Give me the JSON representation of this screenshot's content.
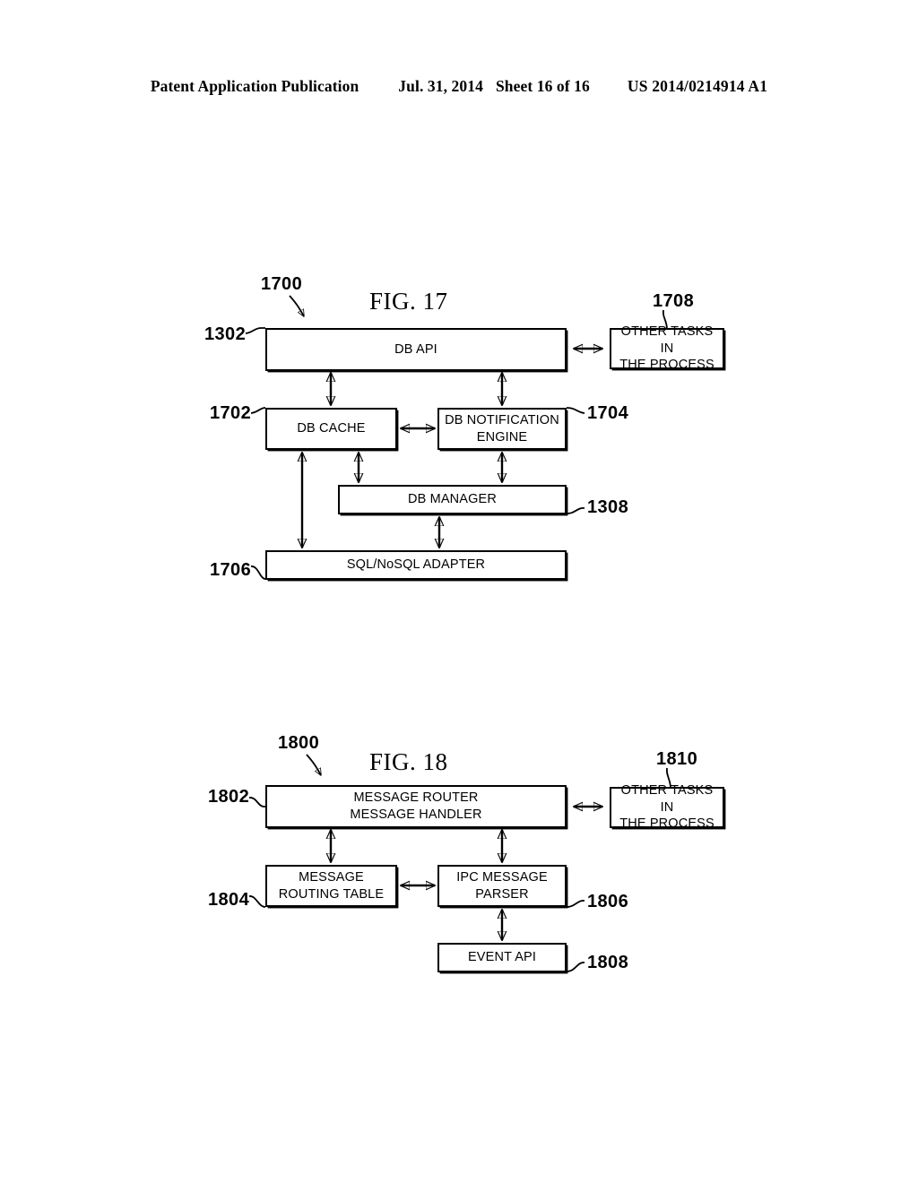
{
  "header": {
    "publication": "Patent Application Publication",
    "date": "Jul. 31, 2014",
    "sheet": "Sheet 16 of 16",
    "patent_number": "US 2014/0214914 A1"
  },
  "figures": [
    {
      "id": "fig-17",
      "title": "FIG. 17",
      "figure_ref": "1700",
      "boxes": [
        {
          "ref": "1302",
          "label": "DB API"
        },
        {
          "ref": "1708",
          "label": "OTHER TASKS IN\nTHE PROCESS"
        },
        {
          "ref": "1702",
          "label": "DB CACHE"
        },
        {
          "ref": "1704",
          "label": "DB NOTIFICATION\nENGINE"
        },
        {
          "ref": "1308",
          "label": "DB MANAGER"
        },
        {
          "ref": "1706",
          "label": "SQL/NoSQL ADAPTER"
        }
      ]
    },
    {
      "id": "fig-18",
      "title": "FIG. 18",
      "figure_ref": "1800",
      "boxes": [
        {
          "ref": "1802",
          "label": "MESSAGE ROUTER\nMESSAGE HANDLER"
        },
        {
          "ref": "1810",
          "label": "OTHER TASKS IN\nTHE PROCESS"
        },
        {
          "ref": "1804",
          "label": "MESSAGE\nROUTING TABLE"
        },
        {
          "ref": "1806",
          "label": "IPC MESSAGE\nPARSER"
        },
        {
          "ref": "1808",
          "label": "EVENT API"
        }
      ]
    }
  ]
}
